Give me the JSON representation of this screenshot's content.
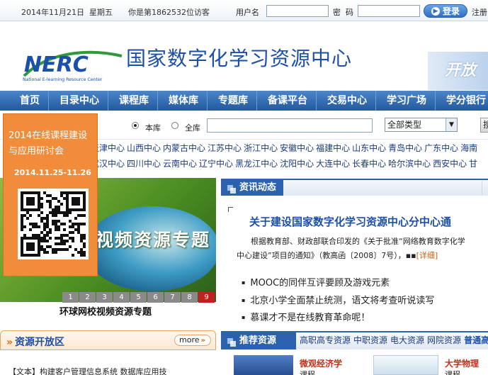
{
  "topbar": {
    "date": "2014年11月21日",
    "weekday": "星期五",
    "visitor_text": "你是第1862532位访客",
    "username_label": "用户名",
    "password_label": "密  码",
    "login_label": "登录",
    "register_label": "注册"
  },
  "header": {
    "logo_text": "NERC",
    "logo_subtitle": "National E-learning Resource Center",
    "site_title": "国家数字化学习资源中心",
    "banner_text": "开放"
  },
  "nav": [
    "首页",
    "目录中心",
    "课程库",
    "媒体库",
    "专题库",
    "备课平台",
    "交易中心",
    "学习广场",
    "学分银行"
  ],
  "search": {
    "scope_this": "本库",
    "scope_all": "全库",
    "keyword": "",
    "type_selected": "全部类型",
    "button_label": "搜"
  },
  "centers": {
    "row1": [
      "天津中心",
      "山西中心",
      "内蒙古中心",
      "江苏中心",
      "浙江中心",
      "安徽中心",
      "福建中心",
      "山东中心",
      "青岛中心",
      "广东中心",
      "海南"
    ],
    "row2": [
      "武汉中心",
      "四川中心",
      "云南中心",
      "辽宁中心",
      "黑龙江中心",
      "沈阳中心",
      "大连中心",
      "长春中心",
      "哈尔滨中心",
      "西安中心",
      "甘"
    ]
  },
  "float_ad": {
    "title": "2014在线课程建设与应用研讨会",
    "dates": "2014.11.25-11.26"
  },
  "slide": {
    "title_text": "视频资源专题",
    "numbers": [
      "1",
      "2",
      "3",
      "4",
      "5",
      "6",
      "7",
      "8",
      "9"
    ],
    "active_number": "9",
    "caption": "环球网校视频资源专题"
  },
  "news": {
    "tab_label": "资讯动态",
    "headline": "关于建设国家数字化学习资源中心分中心通",
    "summary_line1": "根据教育部、财政部联合印发的《关于批准“网络教育数字化学",
    "summary_line2": "中心建设”项目的通知》（教高函〔2008〕7号），",
    "summary_more": "[详细]",
    "items": [
      "MOOC的同伴互评要顾及游戏元素",
      "北京小学全面禁止统测，语文将考查听说读写",
      "慕课才不是在线教育革命呢！"
    ]
  },
  "open_resources": {
    "title": "资源开放区",
    "more_label": "more",
    "first_item": "【文本】构建客户管理信息系统 数据库应用技"
  },
  "recommended": {
    "tab_label": "推荐资源",
    "links": [
      "高职高专资源",
      "中职资源",
      "电大资源",
      "网院资源"
    ],
    "highlight_link": "普通高",
    "card1_title": "微观经济学",
    "card1_sub": "课程",
    "card2_title": "大学物理",
    "card2_sub": "课程"
  },
  "colors": {
    "nav_blue": "#22599f",
    "brand_blue": "#1b4fa8",
    "orange": "#f08c3a",
    "active_red": "#c22020"
  }
}
